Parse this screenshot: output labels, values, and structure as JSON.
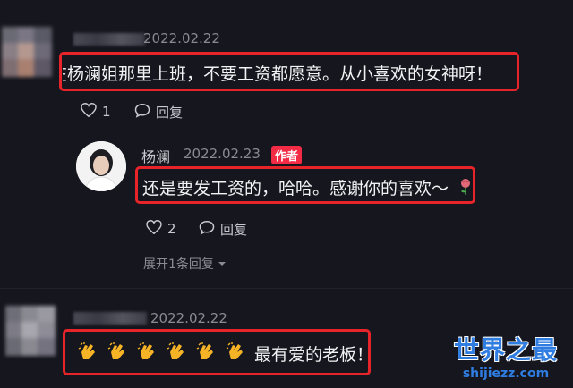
{
  "comment1": {
    "date": "2022.02.22",
    "text": "在杨澜姐那里上班，不要工资都愿意。从小喜欢的女神呀！",
    "likes": "1",
    "reply_label": "回复"
  },
  "reply": {
    "username": "杨澜",
    "date": "2022.02.23",
    "badge": "作者",
    "text": "还是要发工资的，哈哈。感谢你的喜欢～",
    "likes": "2",
    "reply_label": "回复",
    "expand_label": "展开1条回复"
  },
  "comment2": {
    "date": "2022.02.22",
    "text": "最有爱的老板！"
  },
  "watermark": {
    "title": "世界之最",
    "url": "shijiezz.com"
  },
  "colors": {
    "highlight": "#e8242b",
    "badge": "#f42b45",
    "watermark": "#2f7de1"
  }
}
